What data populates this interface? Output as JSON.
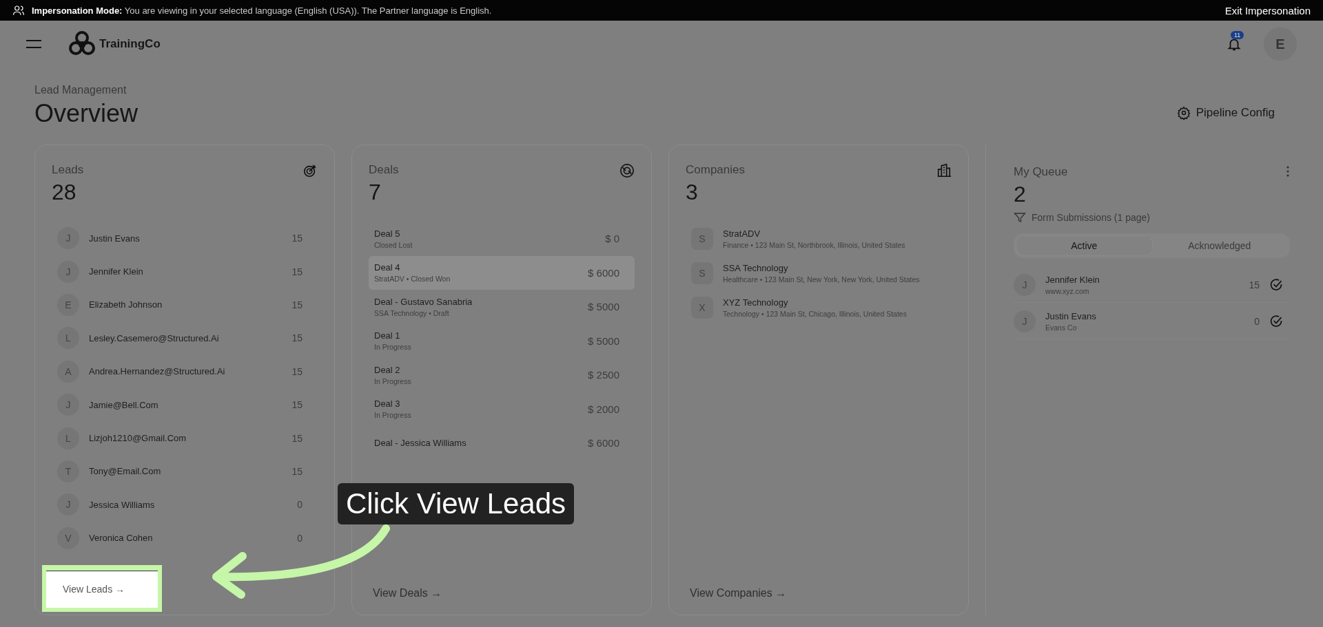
{
  "banner": {
    "label": "Impersonation Mode:",
    "message": "You are viewing in your selected language (English (USA)). The Partner language is English.",
    "exit_button": "Exit Impersonation"
  },
  "header": {
    "brand": "TrainingCo",
    "notification_count": "11",
    "avatar_initial": "E"
  },
  "page": {
    "breadcrumb": "Lead Management",
    "title": "Overview",
    "config_button": "Pipeline Config"
  },
  "leads": {
    "title": "Leads",
    "count": "28",
    "link": "View Leads →",
    "items": [
      {
        "initial": "J",
        "name": "Justin Evans",
        "score": "15"
      },
      {
        "initial": "J",
        "name": "Jennifer Klein",
        "score": "15"
      },
      {
        "initial": "E",
        "name": "Elizabeth Johnson",
        "score": "15"
      },
      {
        "initial": "L",
        "name": "Lesley.Casemero@Structured.Ai",
        "score": "15"
      },
      {
        "initial": "A",
        "name": "Andrea.Hernandez@Structured.Ai",
        "score": "15"
      },
      {
        "initial": "J",
        "name": "Jamie@Bell.Com",
        "score": "15"
      },
      {
        "initial": "L",
        "name": "Lizjoh1210@Gmail.Com",
        "score": "15"
      },
      {
        "initial": "T",
        "name": "Tony@Email.Com",
        "score": "15"
      },
      {
        "initial": "J",
        "name": "Jessica Williams",
        "score": "0"
      },
      {
        "initial": "V",
        "name": "Veronica Cohen",
        "score": "0"
      }
    ]
  },
  "deals": {
    "title": "Deals",
    "count": "7",
    "link": "View Deals →",
    "items": [
      {
        "name": "Deal 5",
        "subtitle": "Closed Lost",
        "amount": "$ 0",
        "highlighted": false
      },
      {
        "name": "Deal 4",
        "subtitle": "StratADV • Closed Won",
        "amount": "$ 6000",
        "highlighted": true
      },
      {
        "name": "Deal - Gustavo Sanabria",
        "subtitle": "SSA Technology • Draft",
        "amount": "$ 5000",
        "highlighted": false
      },
      {
        "name": "Deal 1",
        "subtitle": "In Progress",
        "amount": "$ 5000",
        "highlighted": false
      },
      {
        "name": "Deal 2",
        "subtitle": "In Progress",
        "amount": "$ 2500",
        "highlighted": false
      },
      {
        "name": "Deal 3",
        "subtitle": "In Progress",
        "amount": "$ 2000",
        "highlighted": false
      },
      {
        "name": "Deal - Jessica Williams",
        "amount": "$ 6000",
        "highlighted": false
      }
    ]
  },
  "companies": {
    "title": "Companies",
    "count": "3",
    "link": "View Companies →",
    "items": [
      {
        "initial": "S",
        "name": "StratADV",
        "details": "Finance • 123 Main St, Northbrook, Illinois, United States"
      },
      {
        "initial": "S",
        "name": "SSA Technology",
        "details": "Healthcare • 123 Main St, New York, New York, United States"
      },
      {
        "initial": "X",
        "name": "XYZ Technology",
        "details": "Technology • 123 Main St, Chicago, Illinois, United States"
      }
    ]
  },
  "queue": {
    "title": "My Queue",
    "count": "2",
    "filter": "Form Submissions (1 page)",
    "tabs": [
      {
        "label": "Active",
        "selected": true
      },
      {
        "label": "Acknowledged",
        "selected": false
      }
    ],
    "items": [
      {
        "initial": "J",
        "name": "Jennifer Klein",
        "subtitle": "www.xyz.com",
        "score": "15"
      },
      {
        "initial": "J",
        "name": "Justin Evans",
        "subtitle": "Evans Co",
        "score": "0"
      }
    ]
  },
  "tutorial": {
    "callout": "Click View Leads"
  }
}
